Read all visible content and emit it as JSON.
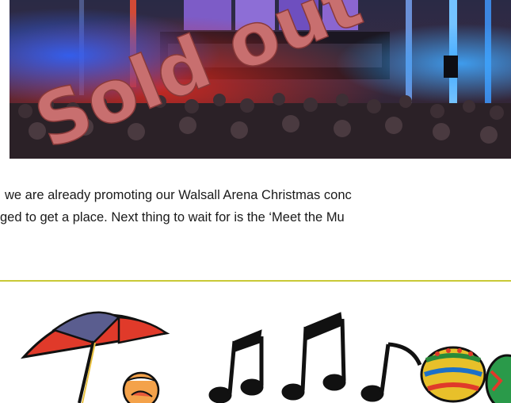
{
  "photo": {
    "stamp_text": "Sold out"
  },
  "article": {
    "line1": "we are already promoting our Walsall Arena Christmas conc",
    "line2": "ged to get a place. Next thing to wait for is the ‘Meet the Mu"
  },
  "colors": {
    "divider": "#c9c936",
    "stamp": "#c86f6f",
    "stage_blue": "#2d63ff",
    "stage_red": "#e0281c"
  }
}
